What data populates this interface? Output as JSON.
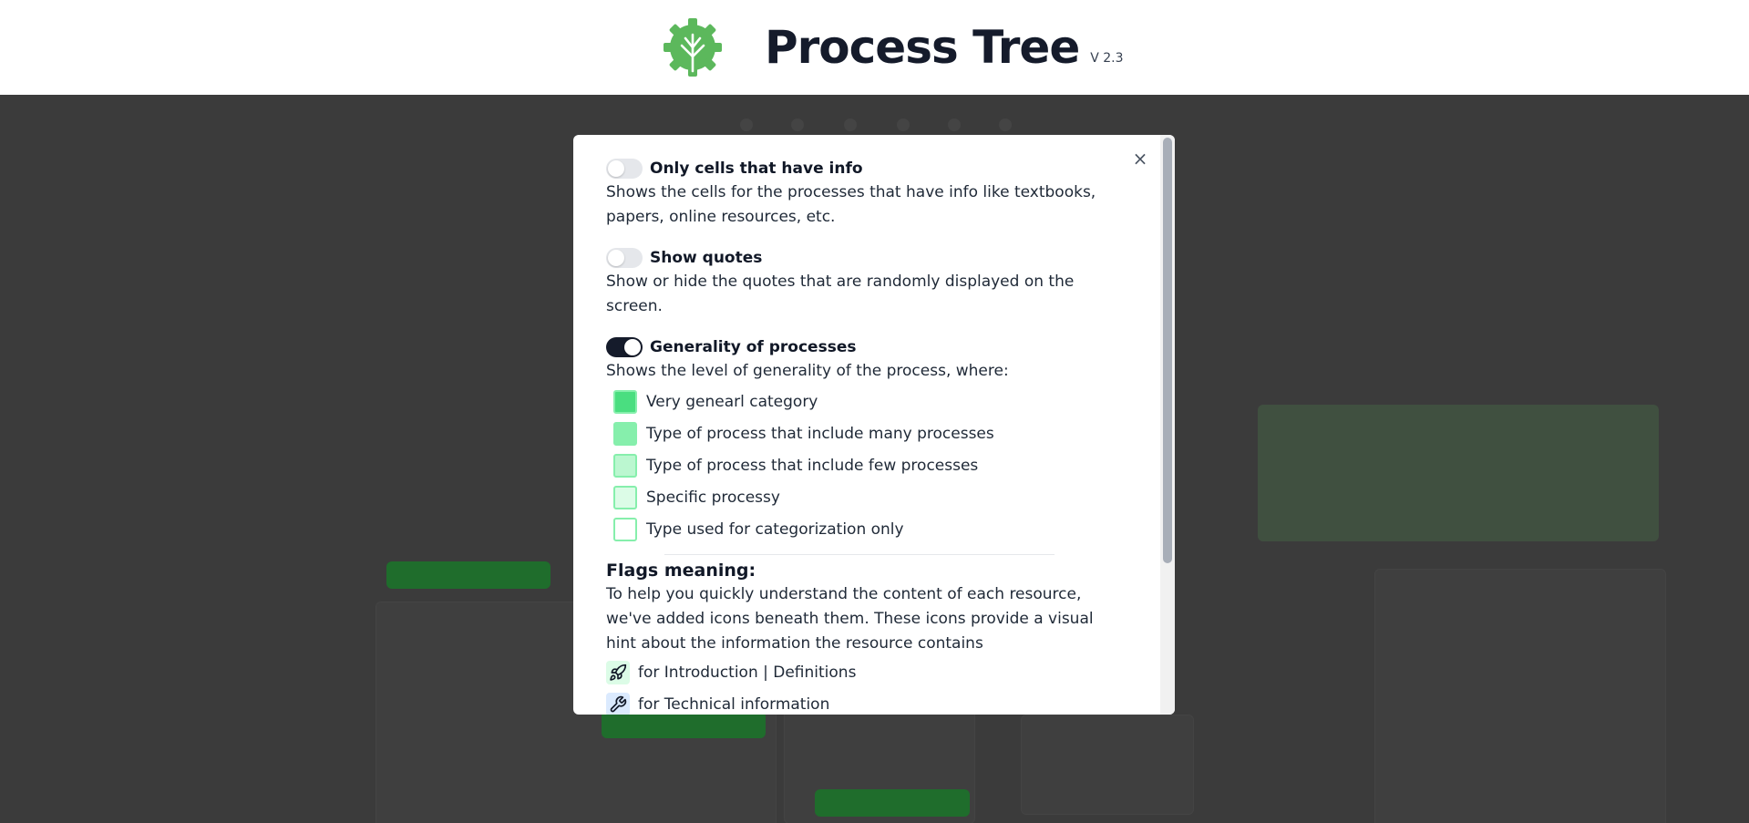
{
  "header": {
    "title": "Process Tree",
    "version": "V 2.3",
    "logo_icon": "tree-gear-logo"
  },
  "modal": {
    "close_label": "×",
    "settings": [
      {
        "title": "Only cells that have info",
        "description": "Shows the cells for the processes that have info like textbooks, papers, online resources, etc.",
        "enabled": false
      },
      {
        "title": "Show quotes",
        "description": "Show or hide the quotes that are randomly displayed on the screen.",
        "enabled": false
      },
      {
        "title": "Generality of processes",
        "description": "Shows the level of generality of the process, where:",
        "enabled": true
      }
    ],
    "generality_legend": [
      {
        "label": "Very genearl category",
        "color": "#4ade80"
      },
      {
        "label": "Type of process that include many processes",
        "color": "#86efac"
      },
      {
        "label": "Type of process that include few processes",
        "color": "#bbf7d0"
      },
      {
        "label": "Specific processy",
        "color": "#dcfce7"
      },
      {
        "label": "Type used for categorization only",
        "color": "#ffffff"
      }
    ],
    "flags": {
      "title": "Flags meaning:",
      "description": "To help you quickly understand the content of each resource, we've added icons beneath them. These icons provide a visual hint about the information the resource contains",
      "items": [
        {
          "label": "for Introduction | Definitions",
          "icon": "rocket-icon",
          "bg": "#dcfce7"
        },
        {
          "label": "for Technical information",
          "icon": "wrench-icon",
          "bg": "#dbeafe"
        }
      ]
    }
  },
  "colors": {
    "toggle_on": "#151b2b",
    "toggle_off": "#e5e7eb",
    "logo_green": "#5cb85c",
    "swatch_border": "#86efac"
  }
}
